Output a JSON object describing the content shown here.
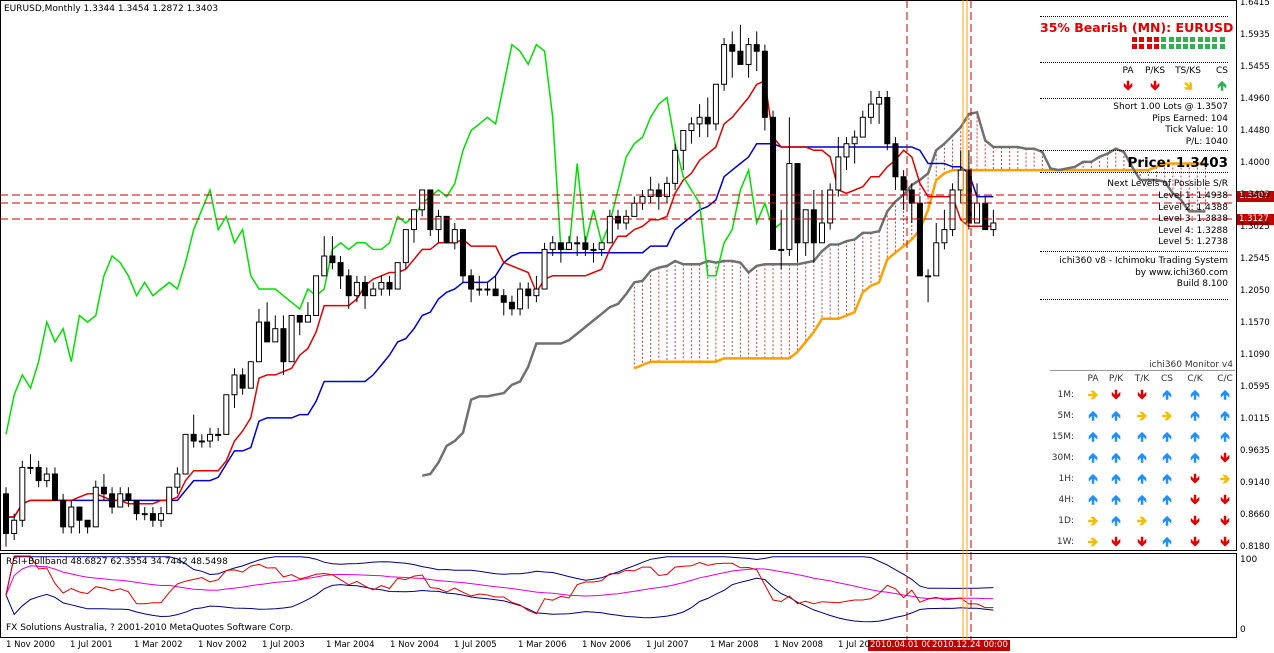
{
  "symbol_header": "EURUSD,Monthly  1.3344 1.3454 1.2872 1.3403",
  "price_ticks": [
    "1.6415",
    "1.5935",
    "1.5455",
    "1.4960",
    "1.4480",
    "1.4000",
    "1.3403",
    "1.3025",
    "1.2545",
    "1.2050",
    "1.1570",
    "1.1090",
    "1.0595",
    "1.0115",
    "0.9635",
    "0.9140",
    "0.8660",
    "0.8180"
  ],
  "price_marker_1": "1.3507",
  "price_marker_2": "1.3127",
  "date_ticks": [
    "1 Nov 2000",
    "1 Jul 2001",
    "1 Mar 2002",
    "1 Nov 2002",
    "1 Jul 2003",
    "1 Mar 2004",
    "1 Nov 2004",
    "1 Jul 2005",
    "1 Mar 2006",
    "1 Nov 2006",
    "1 Jul 2007",
    "1 Mar 2008",
    "1 Nov 2008",
    "1 Jul 20"
  ],
  "date_marker_1": "2010.04.01 00",
  "date_marker_2": "2010.12.24 00:00",
  "panel": {
    "title": "35% Bearish (MN): EURUSD",
    "signal_headers": [
      "PA",
      "P/KS",
      "TS/KS",
      "CS"
    ],
    "signal_arrows": [
      {
        "icon": "arrow-down-icon",
        "glyph": "🡻",
        "color": "#e00000"
      },
      {
        "icon": "arrow-down-icon",
        "glyph": "🡻",
        "color": "#e00000"
      },
      {
        "icon": "arrow-down-right-icon",
        "glyph": "🡾",
        "color": "#f0c000"
      },
      {
        "icon": "arrow-up-icon",
        "glyph": "🡹",
        "color": "#30b050"
      }
    ],
    "trade_lines": [
      "Short 1.00 Lots @ 1.3507",
      "Pips Earned: 104",
      "Tick Value: 10",
      "P/L: 1040"
    ],
    "price_label": "Price: 1.3403",
    "sr_title": "Next Levels of Possible S/R",
    "sr_levels": [
      "Level 1: 1.4938",
      "Level 2: 1.4388",
      "Level 3: 1.3838",
      "Level 4: 1.3288",
      "Level 5: 1.2738"
    ],
    "system_lines": [
      "ichi360 v8 - Ichimoku Trading System",
      "by www.ichi360.com",
      "Build 8.100"
    ]
  },
  "monitor": {
    "title": "ichi360 Monitor v4",
    "headers": [
      "PA",
      "P/K",
      "T/K",
      "CS",
      "C/K",
      "C/C"
    ],
    "rows": [
      {
        "label": "1M:",
        "cells": [
          "right-yellow",
          "down-red",
          "down-red",
          "up-blue",
          "up-blue",
          "up-blue"
        ]
      },
      {
        "label": "5M:",
        "cells": [
          "up-blue",
          "up-blue",
          "right-yellow",
          "right-yellow",
          "up-blue",
          "up-blue"
        ]
      },
      {
        "label": "15M:",
        "cells": [
          "up-blue",
          "up-blue",
          "up-blue",
          "up-blue",
          "up-blue",
          "up-blue"
        ]
      },
      {
        "label": "30M:",
        "cells": [
          "up-blue",
          "up-blue",
          "up-blue",
          "up-blue",
          "up-blue",
          "down-red"
        ]
      },
      {
        "label": "1H:",
        "cells": [
          "up-blue",
          "up-blue",
          "up-blue",
          "up-blue",
          "down-red",
          "right-yellow"
        ]
      },
      {
        "label": "4H:",
        "cells": [
          "up-blue",
          "up-blue",
          "up-blue",
          "up-blue",
          "down-red",
          "down-red"
        ]
      },
      {
        "label": "1D:",
        "cells": [
          "right-yellow",
          "up-blue",
          "right-yellow",
          "up-blue",
          "down-red",
          "down-red"
        ]
      },
      {
        "label": "1W:",
        "cells": [
          "right-yellow",
          "down-red",
          "down-red",
          "up-blue",
          "down-red",
          "down-red"
        ]
      }
    ]
  },
  "rsi": {
    "label": "RSI+Bollband 48.6827 62.3554 34.7442 48.5498",
    "ticks": [
      "100",
      "0"
    ]
  },
  "copyright": "FX Solutions Australia, ? 2001-2010 MetaQuotes Software Corp.",
  "colors": {
    "bull": "#ffffff",
    "bear": "#000000",
    "tenkan": "#e00000",
    "kijun": "#0000cc",
    "chikou": "#00e000",
    "senkou_a": "#707070",
    "senkou_b": "#ffa000",
    "cloud": "#c04040",
    "rsi": "#e00000",
    "rsi_mid": "#e000e0",
    "bb": "#000080"
  },
  "chart_data": {
    "type": "candlestick",
    "timeframe": "Monthly",
    "symbol": "EURUSD",
    "ylim": [
      0.818,
      1.6415
    ],
    "x_start": "2000-08",
    "ohlc": [
      [
        0.9,
        0.91,
        0.82,
        0.84
      ],
      [
        0.84,
        0.87,
        0.83,
        0.86
      ],
      [
        0.86,
        0.95,
        0.85,
        0.94
      ],
      [
        0.94,
        0.96,
        0.93,
        0.94
      ],
      [
        0.94,
        0.95,
        0.91,
        0.92
      ],
      [
        0.92,
        0.94,
        0.91,
        0.93
      ],
      [
        0.93,
        0.94,
        0.89,
        0.89
      ],
      [
        0.89,
        0.9,
        0.84,
        0.85
      ],
      [
        0.85,
        0.89,
        0.84,
        0.88
      ],
      [
        0.88,
        0.88,
        0.84,
        0.86
      ],
      [
        0.86,
        0.86,
        0.84,
        0.85
      ],
      [
        0.85,
        0.92,
        0.85,
        0.91
      ],
      [
        0.91,
        0.93,
        0.89,
        0.9
      ],
      [
        0.9,
        0.91,
        0.87,
        0.88
      ],
      [
        0.88,
        0.91,
        0.88,
        0.9
      ],
      [
        0.9,
        0.91,
        0.88,
        0.89
      ],
      [
        0.89,
        0.89,
        0.86,
        0.87
      ],
      [
        0.87,
        0.88,
        0.86,
        0.87
      ],
      [
        0.87,
        0.88,
        0.85,
        0.86
      ],
      [
        0.86,
        0.88,
        0.85,
        0.87
      ],
      [
        0.87,
        0.91,
        0.87,
        0.91
      ],
      [
        0.91,
        0.94,
        0.9,
        0.93
      ],
      [
        0.93,
        0.99,
        0.93,
        0.99
      ],
      [
        0.99,
        1.02,
        0.97,
        0.98
      ],
      [
        0.98,
        0.99,
        0.97,
        0.98
      ],
      [
        0.98,
        1.0,
        0.97,
        0.99
      ],
      [
        0.99,
        1.0,
        0.98,
        0.99
      ],
      [
        0.99,
        1.05,
        0.99,
        1.05
      ],
      [
        1.05,
        1.09,
        1.03,
        1.08
      ],
      [
        1.08,
        1.09,
        1.05,
        1.06
      ],
      [
        1.06,
        1.1,
        1.06,
        1.1
      ],
      [
        1.1,
        1.18,
        1.1,
        1.16
      ],
      [
        1.16,
        1.19,
        1.13,
        1.13
      ],
      [
        1.13,
        1.17,
        1.13,
        1.15
      ],
      [
        1.15,
        1.17,
        1.08,
        1.1
      ],
      [
        1.1,
        1.17,
        1.1,
        1.17
      ],
      [
        1.17,
        1.17,
        1.14,
        1.16
      ],
      [
        1.16,
        1.19,
        1.16,
        1.17
      ],
      [
        1.17,
        1.23,
        1.17,
        1.23
      ],
      [
        1.23,
        1.29,
        1.23,
        1.26
      ],
      [
        1.26,
        1.29,
        1.24,
        1.25
      ],
      [
        1.25,
        1.26,
        1.21,
        1.23
      ],
      [
        1.23,
        1.24,
        1.18,
        1.2
      ],
      [
        1.2,
        1.23,
        1.19,
        1.22
      ],
      [
        1.22,
        1.23,
        1.18,
        1.2
      ],
      [
        1.2,
        1.22,
        1.2,
        1.21
      ],
      [
        1.21,
        1.23,
        1.2,
        1.22
      ],
      [
        1.22,
        1.23,
        1.2,
        1.21
      ],
      [
        1.21,
        1.25,
        1.21,
        1.25
      ],
      [
        1.25,
        1.3,
        1.24,
        1.3
      ],
      [
        1.3,
        1.33,
        1.28,
        1.33
      ],
      [
        1.33,
        1.36,
        1.32,
        1.36
      ],
      [
        1.36,
        1.36,
        1.29,
        1.3
      ],
      [
        1.3,
        1.33,
        1.28,
        1.32
      ],
      [
        1.32,
        1.32,
        1.28,
        1.28
      ],
      [
        1.28,
        1.31,
        1.27,
        1.3
      ],
      [
        1.3,
        1.3,
        1.22,
        1.23
      ],
      [
        1.23,
        1.24,
        1.19,
        1.21
      ],
      [
        1.21,
        1.23,
        1.2,
        1.21
      ],
      [
        1.21,
        1.22,
        1.2,
        1.21
      ],
      [
        1.21,
        1.23,
        1.2,
        1.2
      ],
      [
        1.2,
        1.21,
        1.17,
        1.19
      ],
      [
        1.19,
        1.2,
        1.17,
        1.18
      ],
      [
        1.18,
        1.22,
        1.17,
        1.21
      ],
      [
        1.21,
        1.22,
        1.18,
        1.2
      ],
      [
        1.2,
        1.23,
        1.19,
        1.21
      ],
      [
        1.21,
        1.28,
        1.21,
        1.27
      ],
      [
        1.27,
        1.29,
        1.26,
        1.28
      ],
      [
        1.28,
        1.28,
        1.25,
        1.27
      ],
      [
        1.27,
        1.29,
        1.27,
        1.28
      ],
      [
        1.28,
        1.29,
        1.26,
        1.28
      ],
      [
        1.28,
        1.29,
        1.26,
        1.27
      ],
      [
        1.27,
        1.28,
        1.25,
        1.27
      ],
      [
        1.27,
        1.28,
        1.26,
        1.28
      ],
      [
        1.28,
        1.33,
        1.28,
        1.32
      ],
      [
        1.32,
        1.33,
        1.3,
        1.31
      ],
      [
        1.31,
        1.33,
        1.3,
        1.32
      ],
      [
        1.32,
        1.35,
        1.32,
        1.34
      ],
      [
        1.34,
        1.36,
        1.33,
        1.35
      ],
      [
        1.35,
        1.38,
        1.34,
        1.36
      ],
      [
        1.36,
        1.37,
        1.33,
        1.35
      ],
      [
        1.35,
        1.38,
        1.34,
        1.37
      ],
      [
        1.37,
        1.43,
        1.36,
        1.42
      ],
      [
        1.42,
        1.45,
        1.39,
        1.45
      ],
      [
        1.45,
        1.47,
        1.43,
        1.46
      ],
      [
        1.46,
        1.49,
        1.44,
        1.47
      ],
      [
        1.47,
        1.5,
        1.44,
        1.46
      ],
      [
        1.46,
        1.52,
        1.45,
        1.52
      ],
      [
        1.52,
        1.59,
        1.51,
        1.58
      ],
      [
        1.58,
        1.6,
        1.53,
        1.57
      ],
      [
        1.57,
        1.61,
        1.55,
        1.55
      ],
      [
        1.55,
        1.59,
        1.53,
        1.58
      ],
      [
        1.58,
        1.6,
        1.54,
        1.57
      ],
      [
        1.57,
        1.58,
        1.45,
        1.47
      ],
      [
        1.47,
        1.48,
        1.27,
        1.27
      ],
      [
        1.27,
        1.33,
        1.24,
        1.27
      ],
      [
        1.27,
        1.47,
        1.26,
        1.4
      ],
      [
        1.4,
        1.4,
        1.25,
        1.28
      ],
      [
        1.28,
        1.33,
        1.26,
        1.33
      ],
      [
        1.33,
        1.36,
        1.25,
        1.28
      ],
      [
        1.28,
        1.36,
        1.28,
        1.31
      ],
      [
        1.31,
        1.37,
        1.3,
        1.36
      ],
      [
        1.36,
        1.44,
        1.35,
        1.41
      ],
      [
        1.41,
        1.44,
        1.39,
        1.43
      ],
      [
        1.43,
        1.45,
        1.4,
        1.44
      ],
      [
        1.44,
        1.48,
        1.44,
        1.47
      ],
      [
        1.47,
        1.51,
        1.46,
        1.49
      ],
      [
        1.49,
        1.51,
        1.46,
        1.5
      ],
      [
        1.5,
        1.51,
        1.42,
        1.43
      ],
      [
        1.43,
        1.44,
        1.36,
        1.38
      ],
      [
        1.38,
        1.39,
        1.33,
        1.36
      ],
      [
        1.36,
        1.37,
        1.31,
        1.34
      ],
      [
        1.34,
        1.35,
        1.23,
        1.23
      ],
      [
        1.23,
        1.24,
        1.19,
        1.23
      ],
      [
        1.23,
        1.31,
        1.23,
        1.28
      ],
      [
        1.28,
        1.33,
        1.27,
        1.3
      ],
      [
        1.3,
        1.37,
        1.29,
        1.36
      ],
      [
        1.36,
        1.42,
        1.34,
        1.39
      ],
      [
        1.39,
        1.42,
        1.3,
        1.31
      ],
      [
        1.31,
        1.37,
        1.31,
        1.34
      ],
      [
        1.34,
        1.35,
        1.3,
        1.3
      ],
      [
        1.3,
        1.33,
        1.29,
        1.31
      ]
    ]
  }
}
